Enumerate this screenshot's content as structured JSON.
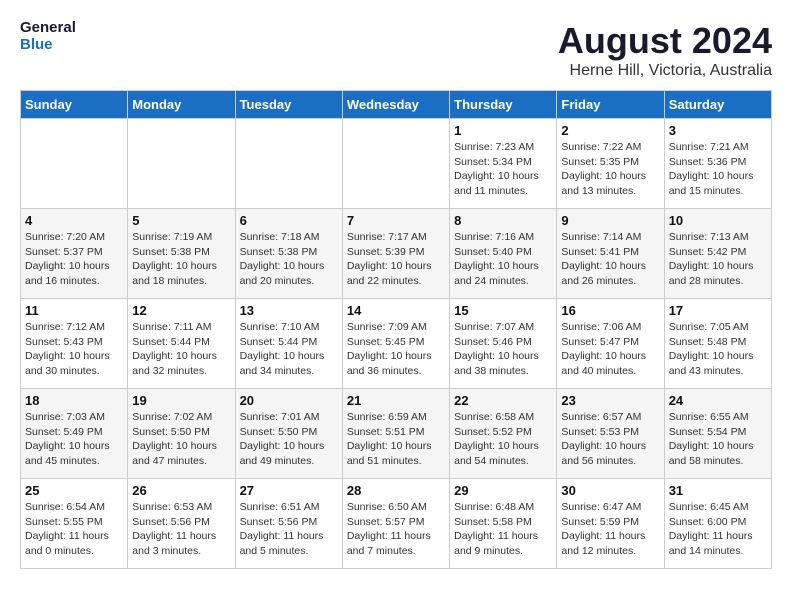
{
  "header": {
    "logo_line1": "General",
    "logo_line2": "Blue",
    "month_title": "August 2024",
    "location": "Herne Hill, Victoria, Australia"
  },
  "weekdays": [
    "Sunday",
    "Monday",
    "Tuesday",
    "Wednesday",
    "Thursday",
    "Friday",
    "Saturday"
  ],
  "weeks": [
    [
      {
        "day": "",
        "info": ""
      },
      {
        "day": "",
        "info": ""
      },
      {
        "day": "",
        "info": ""
      },
      {
        "day": "",
        "info": ""
      },
      {
        "day": "1",
        "info": "Sunrise: 7:23 AM\nSunset: 5:34 PM\nDaylight: 10 hours\nand 11 minutes."
      },
      {
        "day": "2",
        "info": "Sunrise: 7:22 AM\nSunset: 5:35 PM\nDaylight: 10 hours\nand 13 minutes."
      },
      {
        "day": "3",
        "info": "Sunrise: 7:21 AM\nSunset: 5:36 PM\nDaylight: 10 hours\nand 15 minutes."
      }
    ],
    [
      {
        "day": "4",
        "info": "Sunrise: 7:20 AM\nSunset: 5:37 PM\nDaylight: 10 hours\nand 16 minutes."
      },
      {
        "day": "5",
        "info": "Sunrise: 7:19 AM\nSunset: 5:38 PM\nDaylight: 10 hours\nand 18 minutes."
      },
      {
        "day": "6",
        "info": "Sunrise: 7:18 AM\nSunset: 5:38 PM\nDaylight: 10 hours\nand 20 minutes."
      },
      {
        "day": "7",
        "info": "Sunrise: 7:17 AM\nSunset: 5:39 PM\nDaylight: 10 hours\nand 22 minutes."
      },
      {
        "day": "8",
        "info": "Sunrise: 7:16 AM\nSunset: 5:40 PM\nDaylight: 10 hours\nand 24 minutes."
      },
      {
        "day": "9",
        "info": "Sunrise: 7:14 AM\nSunset: 5:41 PM\nDaylight: 10 hours\nand 26 minutes."
      },
      {
        "day": "10",
        "info": "Sunrise: 7:13 AM\nSunset: 5:42 PM\nDaylight: 10 hours\nand 28 minutes."
      }
    ],
    [
      {
        "day": "11",
        "info": "Sunrise: 7:12 AM\nSunset: 5:43 PM\nDaylight: 10 hours\nand 30 minutes."
      },
      {
        "day": "12",
        "info": "Sunrise: 7:11 AM\nSunset: 5:44 PM\nDaylight: 10 hours\nand 32 minutes."
      },
      {
        "day": "13",
        "info": "Sunrise: 7:10 AM\nSunset: 5:44 PM\nDaylight: 10 hours\nand 34 minutes."
      },
      {
        "day": "14",
        "info": "Sunrise: 7:09 AM\nSunset: 5:45 PM\nDaylight: 10 hours\nand 36 minutes."
      },
      {
        "day": "15",
        "info": "Sunrise: 7:07 AM\nSunset: 5:46 PM\nDaylight: 10 hours\nand 38 minutes."
      },
      {
        "day": "16",
        "info": "Sunrise: 7:06 AM\nSunset: 5:47 PM\nDaylight: 10 hours\nand 40 minutes."
      },
      {
        "day": "17",
        "info": "Sunrise: 7:05 AM\nSunset: 5:48 PM\nDaylight: 10 hours\nand 43 minutes."
      }
    ],
    [
      {
        "day": "18",
        "info": "Sunrise: 7:03 AM\nSunset: 5:49 PM\nDaylight: 10 hours\nand 45 minutes."
      },
      {
        "day": "19",
        "info": "Sunrise: 7:02 AM\nSunset: 5:50 PM\nDaylight: 10 hours\nand 47 minutes."
      },
      {
        "day": "20",
        "info": "Sunrise: 7:01 AM\nSunset: 5:50 PM\nDaylight: 10 hours\nand 49 minutes."
      },
      {
        "day": "21",
        "info": "Sunrise: 6:59 AM\nSunset: 5:51 PM\nDaylight: 10 hours\nand 51 minutes."
      },
      {
        "day": "22",
        "info": "Sunrise: 6:58 AM\nSunset: 5:52 PM\nDaylight: 10 hours\nand 54 minutes."
      },
      {
        "day": "23",
        "info": "Sunrise: 6:57 AM\nSunset: 5:53 PM\nDaylight: 10 hours\nand 56 minutes."
      },
      {
        "day": "24",
        "info": "Sunrise: 6:55 AM\nSunset: 5:54 PM\nDaylight: 10 hours\nand 58 minutes."
      }
    ],
    [
      {
        "day": "25",
        "info": "Sunrise: 6:54 AM\nSunset: 5:55 PM\nDaylight: 11 hours\nand 0 minutes."
      },
      {
        "day": "26",
        "info": "Sunrise: 6:53 AM\nSunset: 5:56 PM\nDaylight: 11 hours\nand 3 minutes."
      },
      {
        "day": "27",
        "info": "Sunrise: 6:51 AM\nSunset: 5:56 PM\nDaylight: 11 hours\nand 5 minutes."
      },
      {
        "day": "28",
        "info": "Sunrise: 6:50 AM\nSunset: 5:57 PM\nDaylight: 11 hours\nand 7 minutes."
      },
      {
        "day": "29",
        "info": "Sunrise: 6:48 AM\nSunset: 5:58 PM\nDaylight: 11 hours\nand 9 minutes."
      },
      {
        "day": "30",
        "info": "Sunrise: 6:47 AM\nSunset: 5:59 PM\nDaylight: 11 hours\nand 12 minutes."
      },
      {
        "day": "31",
        "info": "Sunrise: 6:45 AM\nSunset: 6:00 PM\nDaylight: 11 hours\nand 14 minutes."
      }
    ]
  ]
}
